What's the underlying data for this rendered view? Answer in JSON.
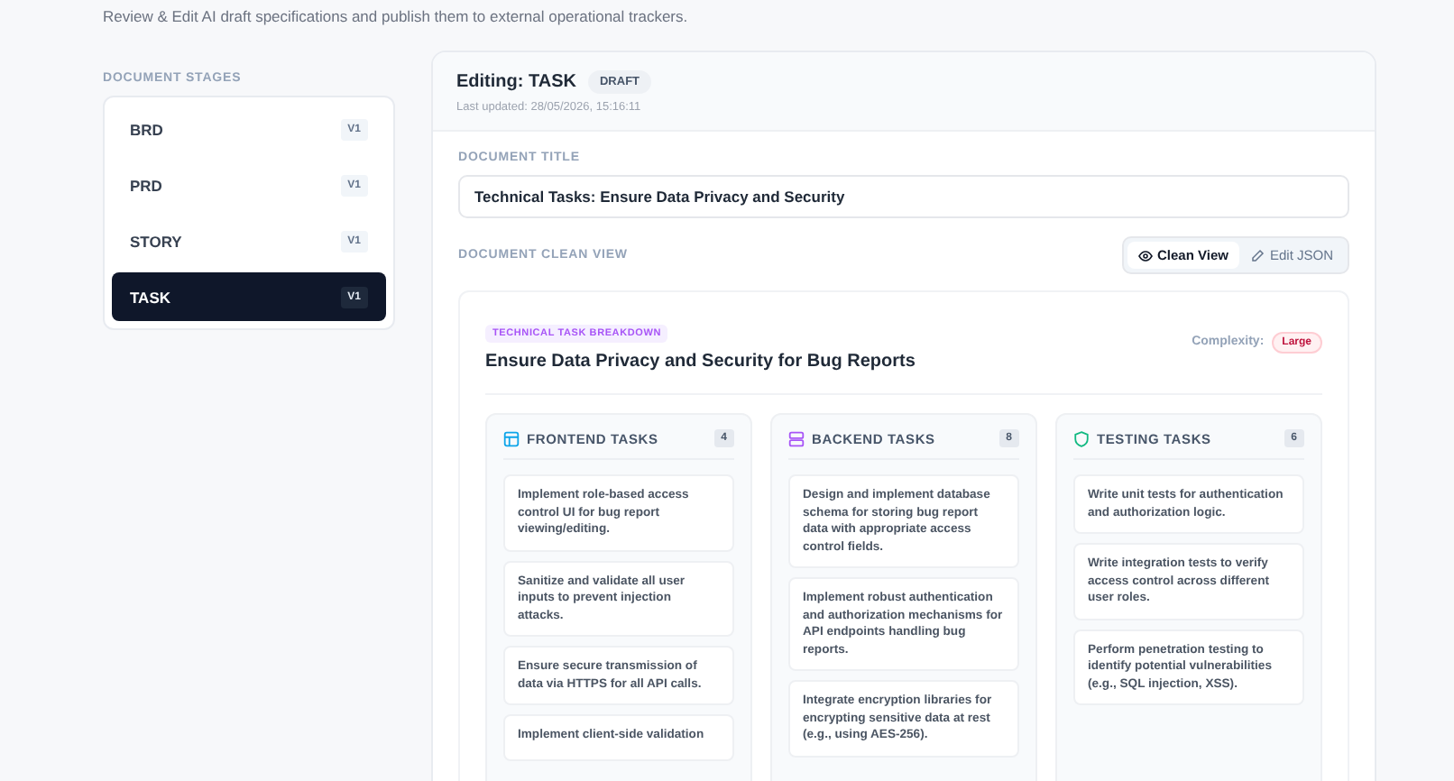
{
  "subtitle": "Review & Edit AI draft specifications and publish them to external operational trackers.",
  "stages": {
    "heading": "DOCUMENT STAGES",
    "items": [
      {
        "label": "BRD",
        "version": "V1",
        "selected": false
      },
      {
        "label": "PRD",
        "version": "V1",
        "selected": false
      },
      {
        "label": "STORY",
        "version": "V1",
        "selected": false
      },
      {
        "label": "TASK",
        "version": "V1",
        "selected": true
      }
    ]
  },
  "editor": {
    "title": "Editing: TASK",
    "status": "DRAFT",
    "updated": "Last updated: 28/05/2026, 15:16:11",
    "title_label": "DOCUMENT TITLE",
    "title_value": "Technical Tasks: Ensure Data Privacy and Security",
    "view_label": "DOCUMENT CLEAN VIEW",
    "view_toggle": [
      {
        "label": "Clean View",
        "kind": "eye",
        "selected": true
      },
      {
        "label": "Edit JSON",
        "kind": "pencil",
        "selected": false
      }
    ],
    "document": {
      "tag": "TECHNICAL TASK BREAKDOWN",
      "heading": "Ensure Data Privacy and Security for Bug Reports",
      "complexity_label": "Complexity:",
      "complexity": "Large",
      "columns": [
        {
          "kind": "frontend",
          "title": "FRONTEND TASKS",
          "count": "4",
          "tasks": [
            "Implement role-based access control UI for bug report viewing/editing.",
            "Sanitize and validate all user inputs to prevent injection attacks.",
            "Ensure secure transmission of data via HTTPS for all API calls.",
            "Implement client-side validation"
          ]
        },
        {
          "kind": "backend",
          "title": "BACKEND TASKS",
          "count": "8",
          "tasks": [
            "Design and implement database schema for storing bug report data with appropriate access control fields.",
            "Implement robust authentication and authorization mechanisms for API endpoints handling bug reports.",
            "Integrate encryption libraries for encrypting sensitive data at rest (e.g., using AES-256)."
          ]
        },
        {
          "kind": "testing",
          "title": "TESTING TASKS",
          "count": "6",
          "tasks": [
            "Write unit tests for authentication and authorization logic.",
            "Write integration tests to verify access control across different user roles.",
            "Perform penetration testing to identify potential vulnerabilities (e.g., SQL injection, XSS)."
          ]
        }
      ]
    }
  }
}
